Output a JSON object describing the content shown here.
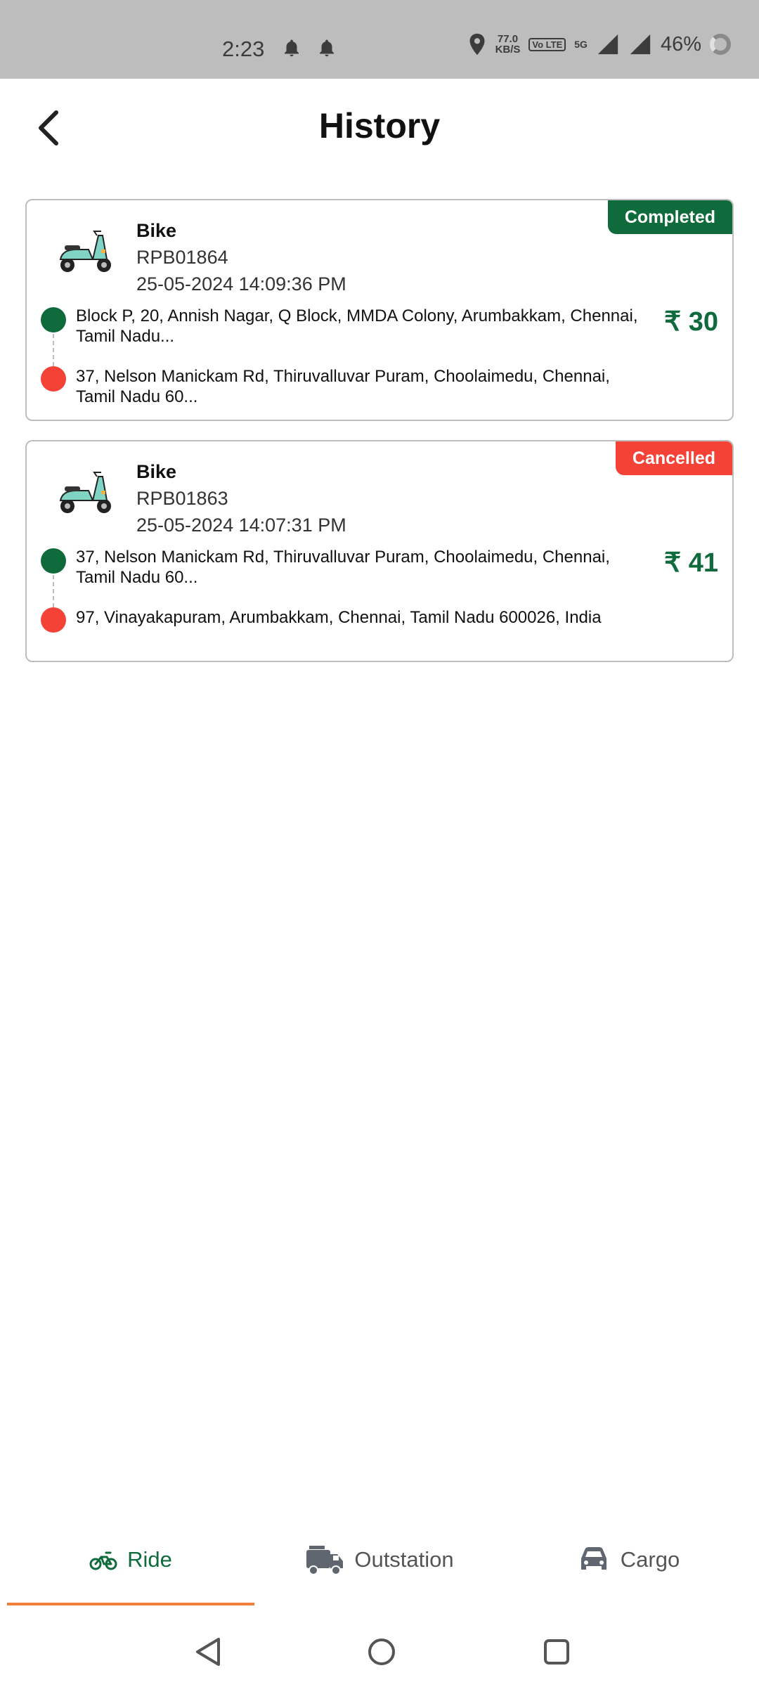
{
  "status_bar": {
    "time": "2:23",
    "speed_value": "77.0",
    "speed_unit": "KB/S",
    "volte_label": "Vo LTE",
    "network_label": "5G",
    "battery": "46%"
  },
  "header": {
    "title": "History"
  },
  "rides": [
    {
      "vehicle": "Bike",
      "booking_id": "RPB01864",
      "datetime": "25-05-2024 14:09:36 PM",
      "status": "Completed",
      "status_color": "#0f6b3c",
      "pickup": "Block P, 20, Annish Nagar, Q Block, MMDA Colony, Arumbakkam, Chennai, Tamil Nadu...",
      "drop": "37, Nelson Manickam Rd, Thiruvalluvar Puram, Choolaimedu, Chennai, Tamil Nadu 60...",
      "fare": "₹ 30"
    },
    {
      "vehicle": "Bike",
      "booking_id": "RPB01863",
      "datetime": "25-05-2024 14:07:31 PM",
      "status": "Cancelled",
      "status_color": "#f44336",
      "pickup": "37, Nelson Manickam Rd, Thiruvalluvar Puram, Choolaimedu, Chennai, Tamil Nadu 60...",
      "drop": "97, Vinayakapuram, Arumbakkam, Chennai, Tamil Nadu 600026, India",
      "fare": "₹ 41"
    }
  ],
  "tabs": [
    {
      "label": "Ride",
      "icon": "motorbike-icon",
      "active": true
    },
    {
      "label": "Outstation",
      "icon": "truck-icon",
      "active": false
    },
    {
      "label": "Cargo",
      "icon": "car-icon",
      "active": false
    }
  ],
  "colors": {
    "brand_green": "#0f6b3c",
    "cancel_red": "#f44336",
    "pickup_dot": "#0f6b3c",
    "drop_dot": "#f44336",
    "tab_indicator": "#f07e3c"
  }
}
